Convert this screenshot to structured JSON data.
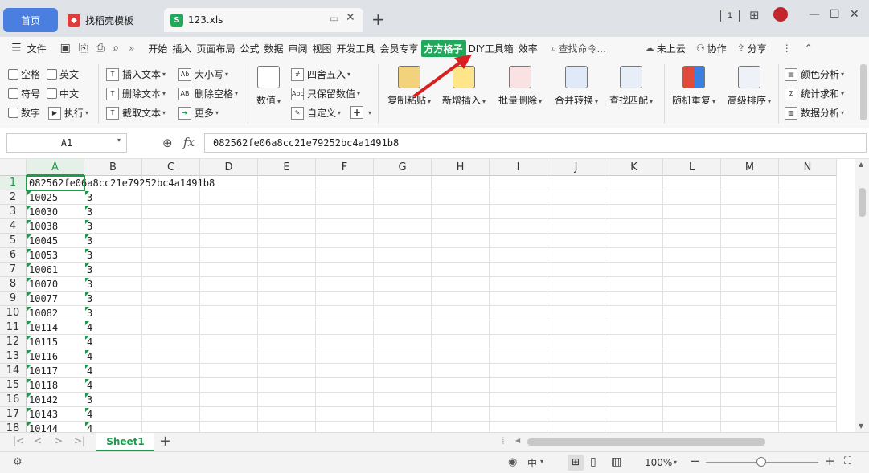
{
  "tabs": {
    "home": "首页",
    "template": "找稻壳模板",
    "file": "123.xls"
  },
  "menu": {
    "file": "文件",
    "items": [
      "开始",
      "插入",
      "页面布局",
      "公式",
      "数据",
      "审阅",
      "视图",
      "开发工具",
      "会员专享",
      "方方格子",
      "DIY工具箱",
      "效率"
    ],
    "active_index": 9,
    "search": "查找命令...",
    "cloud": "未上云",
    "collab": "协作",
    "share": "分享"
  },
  "ribbon": {
    "checks": [
      "空格",
      "英文",
      "符号",
      "中文",
      "数字"
    ],
    "execute": "执行",
    "text_ops": [
      "插入文本",
      "删除文本",
      "截取文本"
    ],
    "case_ops": [
      "大小写",
      "删除空格",
      "更多"
    ],
    "value": "数值",
    "num_ops": [
      "四舍五入",
      "只保留数值",
      "自定义"
    ],
    "big_buttons": [
      "复制粘贴",
      "新增插入",
      "批量删除",
      "合并转换",
      "查找匹配",
      "随机重复",
      "高级排序"
    ],
    "analysis": [
      "颜色分析",
      "统计求和",
      "数据分析"
    ]
  },
  "formula": {
    "cell_ref": "A1",
    "fx": "fx",
    "content": "082562fe06a8cc21e79252bc4a1491b8"
  },
  "columns": [
    "A",
    "B",
    "C",
    "D",
    "E",
    "F",
    "G",
    "H",
    "I",
    "J",
    "K",
    "L",
    "M",
    "N"
  ],
  "rows": [
    {
      "n": "1",
      "a": "082562fe06a8cc21e79252bc4a1491b8",
      "b": ""
    },
    {
      "n": "2",
      "a": "10025",
      "b": "3"
    },
    {
      "n": "3",
      "a": "10030",
      "b": "3"
    },
    {
      "n": "4",
      "a": "10038",
      "b": "3"
    },
    {
      "n": "5",
      "a": "10045",
      "b": "3"
    },
    {
      "n": "6",
      "a": "10053",
      "b": "3"
    },
    {
      "n": "7",
      "a": "10061",
      "b": "3"
    },
    {
      "n": "8",
      "a": "10070",
      "b": "3"
    },
    {
      "n": "9",
      "a": "10077",
      "b": "3"
    },
    {
      "n": "10",
      "a": "10082",
      "b": "3"
    },
    {
      "n": "11",
      "a": "10114",
      "b": "4"
    },
    {
      "n": "12",
      "a": "10115",
      "b": "4"
    },
    {
      "n": "13",
      "a": "10116",
      "b": "4"
    },
    {
      "n": "14",
      "a": "10117",
      "b": "4"
    },
    {
      "n": "15",
      "a": "10118",
      "b": "4"
    },
    {
      "n": "16",
      "a": "10142",
      "b": "3"
    },
    {
      "n": "17",
      "a": "10143",
      "b": "4"
    },
    {
      "n": "18",
      "a": "10144",
      "b": "4"
    }
  ],
  "sheet": {
    "name": "Sheet1"
  },
  "status": {
    "zoom": "100%",
    "input_mode": "中"
  },
  "colors": {
    "accent": "#1e9a4a",
    "home_tab": "#4a7fe0",
    "active_menu": "#21a85a"
  }
}
